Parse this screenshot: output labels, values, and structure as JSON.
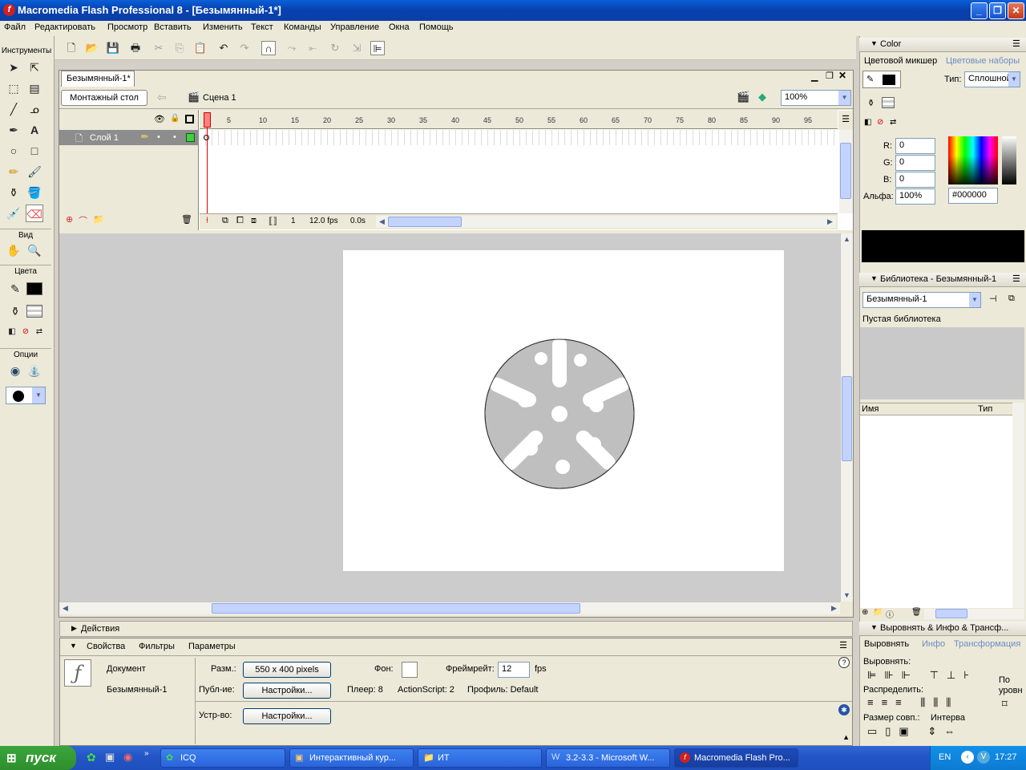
{
  "window": {
    "title": "Macromedia Flash Professional 8 - [Безымянный-1*]"
  },
  "menu": [
    "Файл",
    "Редактировать",
    "Просмотр",
    "Вставить",
    "Изменить",
    "Текст",
    "Команды",
    "Управление",
    "Окна",
    "Помощь"
  ],
  "tools": {
    "title": "Инструменты",
    "view_label": "Вид",
    "colors_label": "Цвета",
    "options_label": "Опции"
  },
  "document": {
    "tab_label": "Безымянный-1*",
    "timeline_button": "Монтажный стол",
    "scene_label": "Сцена 1",
    "zoom": "100%"
  },
  "timeline": {
    "layer_name": "Слой 1",
    "frame_numbers": [
      "1",
      "5",
      "10",
      "15",
      "20",
      "25",
      "30",
      "35",
      "40",
      "45",
      "50",
      "55",
      "60",
      "65",
      "70",
      "75",
      "80",
      "85",
      "90",
      "95"
    ],
    "current_frame": "1",
    "frame_rate": "12.0 fps",
    "elapsed": "0.0s"
  },
  "actions_panel": {
    "label": "Действия"
  },
  "properties": {
    "tabs": [
      "Свойства",
      "Фильтры",
      "Параметры"
    ],
    "doc_type": "Документ",
    "doc_name": "Безымянный-1",
    "size_label": "Разм.:",
    "size_value": "550 x 400 pixels",
    "publish_label": "Публ-ие:",
    "settings_button": "Настройки...",
    "device_label": "Устр-во:",
    "device_button": "Настройки...",
    "bg_label": "Фон:",
    "framerate_label": "Фреймрейт:",
    "framerate_value": "12",
    "fps_unit": "fps",
    "player_label": "Плеер: 8",
    "actionscript_label": "ActionScript:  2",
    "profile_label": "Профиль: Default"
  },
  "color_panel": {
    "header": "Color",
    "tab_mixer": "Цветовой микшер",
    "tab_swatches": "Цветовые наборы",
    "type_label": "Тип:",
    "type_value": "Сплошной",
    "r_label": "R:",
    "r_value": "0",
    "g_label": "G:",
    "g_value": "0",
    "b_label": "B:",
    "b_value": "0",
    "alpha_label": "Альфа:",
    "alpha_value": "100%",
    "hex_value": "#000000"
  },
  "library_panel": {
    "header": "Библиотека - Безымянный-1",
    "selector": "Безымянный-1",
    "status": "Пустая библиотека",
    "col_name": "Имя",
    "col_type": "Тип"
  },
  "align_panel": {
    "header": "Выровнять & Инфо & Трансф...",
    "tab_align": "Выровнять",
    "tab_info": "Инфо",
    "tab_transform": "Трансформация",
    "align_label": "Выровнять:",
    "distribute_label": "Распределить:",
    "match_label": "Размер совп.:",
    "space_label": "Интерва",
    "to_stage_label_1": "По",
    "to_stage_label_2": "уровн"
  },
  "taskbar": {
    "start": "пуск",
    "tasks": [
      "ICQ",
      "Интерактивный кур...",
      "ИТ",
      "3.2-3.3 - Microsoft W...",
      "Macromedia Flash Pro..."
    ],
    "lang": "EN",
    "clock": "17:27"
  },
  "colors": {
    "accent": "#0a5fd8",
    "stage": "#ffffff",
    "shape_fill": "#bfbfbf",
    "workarea": "#cccccc"
  }
}
